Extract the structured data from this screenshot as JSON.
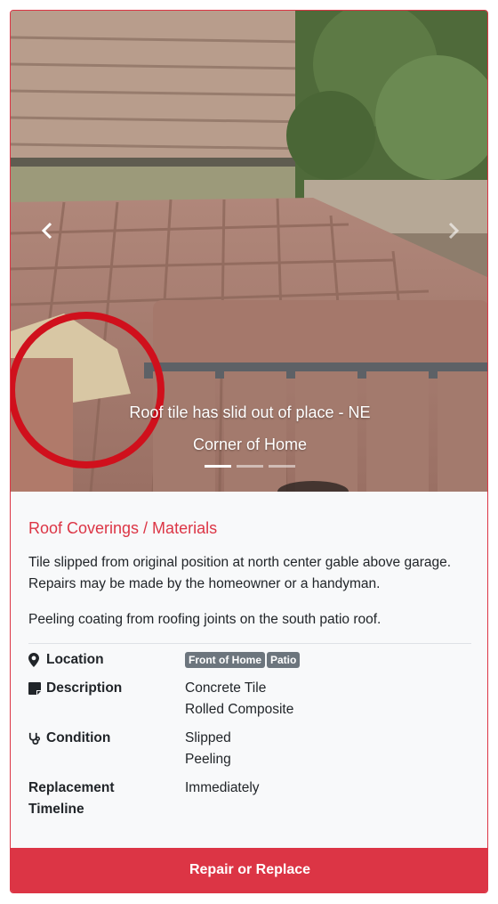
{
  "carousel": {
    "caption_line1": "Roof tile has slid out of place - NE",
    "caption_line2": "Corner of Home",
    "indicator_count": 3,
    "active_index": 0
  },
  "section": {
    "title": "Roof Coverings / Materials",
    "paragraphs": [
      "Tile slipped from original position at north center gable above garage. Repairs may be made by the homeowner or a handyman.",
      "Peeling coating from roofing joints on the south patio roof."
    ]
  },
  "details": {
    "location_label": "Location",
    "location_badges": [
      "Front of Home",
      "Patio"
    ],
    "description_label": "Description",
    "description_values": [
      "Concrete Tile",
      "Rolled Composite"
    ],
    "condition_label": "Condition",
    "condition_values": [
      "Slipped",
      "Peeling"
    ],
    "timeline_label_1": "Replacement",
    "timeline_label_2": "Timeline",
    "timeline_value": "Immediately"
  },
  "action": {
    "label": "Repair or Replace"
  },
  "colors": {
    "accent": "#dc3545",
    "badge": "#6c757d",
    "card_bg": "#f8f9fa"
  },
  "icons": {
    "location": "map-marker-icon",
    "description": "sticky-note-icon",
    "condition": "stethoscope-icon",
    "prev": "chevron-left-icon",
    "next": "chevron-right-icon"
  }
}
